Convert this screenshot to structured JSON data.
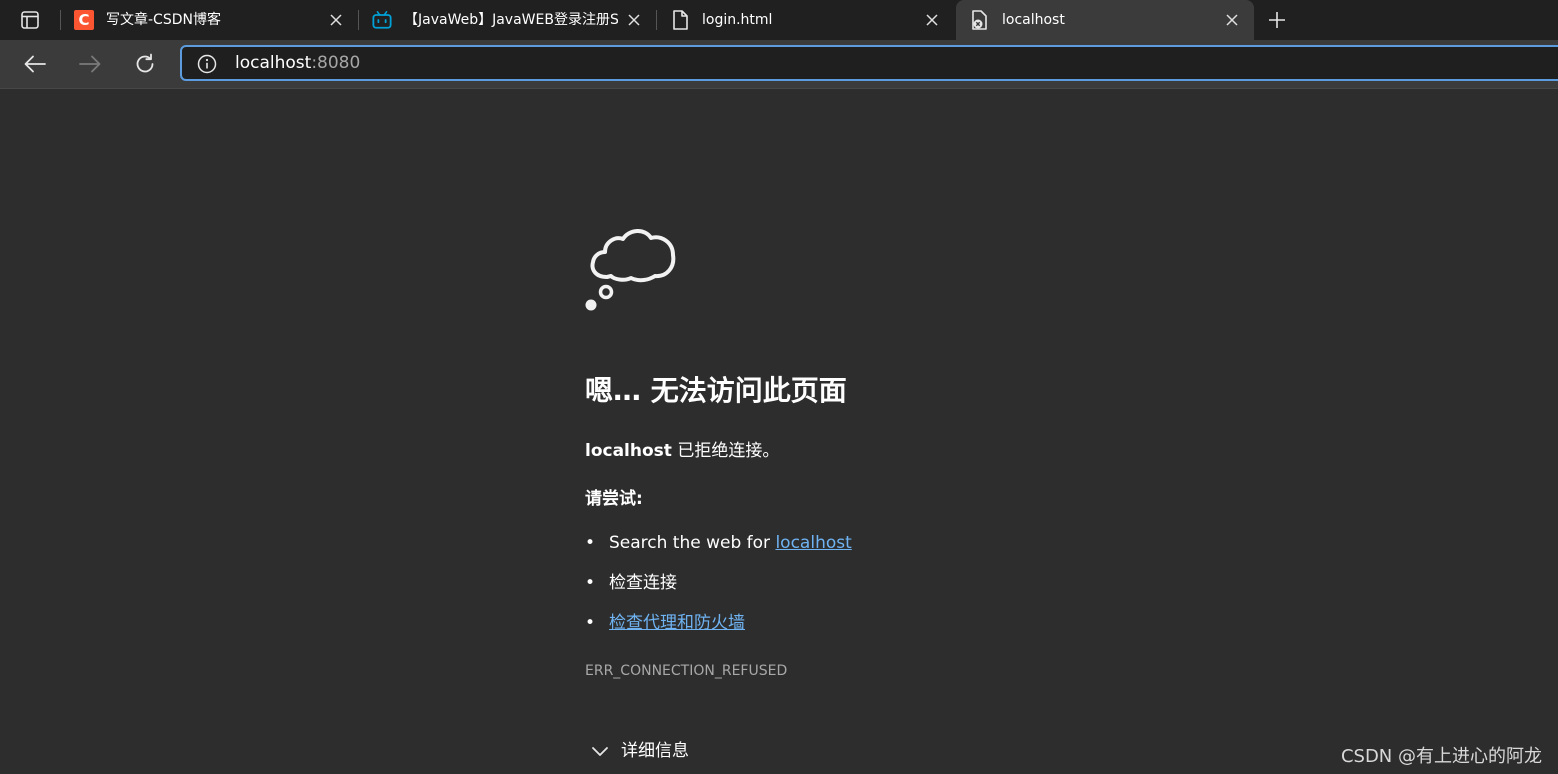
{
  "tabs": [
    {
      "title": "写文章-CSDN博客",
      "favicon": "csdn-logo-icon",
      "favicon_text": "C",
      "active": false
    },
    {
      "title": "【JavaWeb】JavaWEB登录注册S",
      "favicon": "bilibili-tv-icon",
      "active": false
    },
    {
      "title": "login.html",
      "favicon": "document-icon",
      "active": false
    },
    {
      "title": "localhost",
      "favicon": "error-page-icon",
      "active": true
    }
  ],
  "address": {
    "host": "localhost",
    "port": ":8080"
  },
  "page": {
    "heading": "嗯… 无法访问此页面",
    "refused_host": "localhost",
    "refused_text": " 已拒绝连接。",
    "try_label": "请尝试:",
    "suggestions": [
      {
        "prefix": "Search the web for ",
        "link": "localhost"
      },
      {
        "text": "检查连接"
      },
      {
        "link": "检查代理和防火墙"
      }
    ],
    "bullet": "•",
    "error_code": "ERR_CONNECTION_REFUSED",
    "details_label": "详细信息"
  },
  "watermark": "CSDN @有上进心的阿龙",
  "colors": {
    "csdn_red": "#fc5531",
    "bilibili_blue": "#00a1d6",
    "link": "#6fb3f2",
    "focus_ring": "#5c9cde"
  }
}
